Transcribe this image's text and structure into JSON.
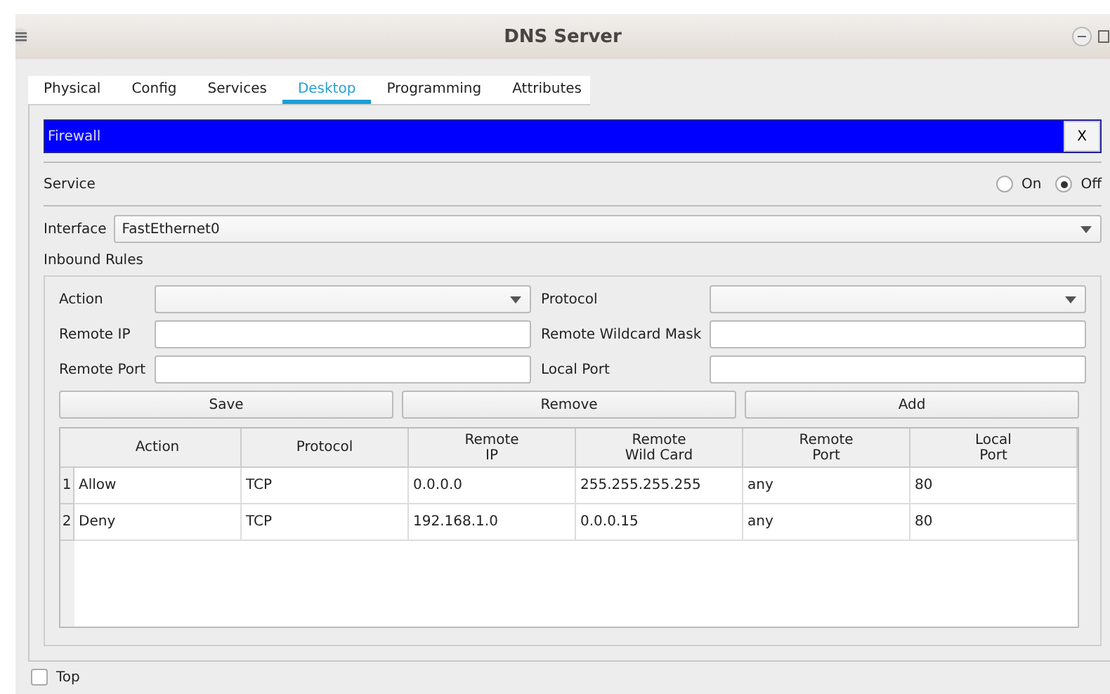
{
  "window": {
    "title": "DNS Server"
  },
  "tabs": [
    {
      "label": "Physical",
      "selected": false
    },
    {
      "label": "Config",
      "selected": false
    },
    {
      "label": "Services",
      "selected": false
    },
    {
      "label": "Desktop",
      "selected": true
    },
    {
      "label": "Programming",
      "selected": false
    },
    {
      "label": "Attributes",
      "selected": false
    }
  ],
  "app": {
    "title": "Firewall",
    "close_button": "X"
  },
  "service": {
    "label": "Service",
    "options": [
      {
        "label": "On",
        "selected": false
      },
      {
        "label": "Off",
        "selected": true
      }
    ]
  },
  "interface": {
    "label": "Interface",
    "value": "FastEthernet0"
  },
  "inbound_rules": {
    "label": "Inbound Rules",
    "fields": [
      {
        "label": "Action",
        "kind": "select"
      },
      {
        "label": "Protocol",
        "kind": "select"
      },
      {
        "label": "Remote IP",
        "kind": "input"
      },
      {
        "label": "Remote Wildcard Mask",
        "kind": "input"
      },
      {
        "label": "Remote Port",
        "kind": "input"
      },
      {
        "label": "Local Port",
        "kind": "input"
      }
    ],
    "buttons": [
      "Save",
      "Remove",
      "Add"
    ],
    "table": {
      "columns": [
        "Action",
        "Protocol",
        "Remote\nIP",
        "Remote\nWild Card",
        "Remote\nPort",
        "Local\nPort"
      ],
      "rows": [
        {
          "number": "1",
          "cells": [
            "Allow",
            "TCP",
            "0.0.0.0",
            "255.255.255.255",
            "any",
            "80"
          ]
        },
        {
          "number": "2",
          "cells": [
            "Deny",
            "TCP",
            "192.168.1.0",
            "0.0.0.15",
            "any",
            "80"
          ]
        }
      ]
    }
  },
  "top_checkbox": {
    "label": "Top",
    "checked": false
  }
}
